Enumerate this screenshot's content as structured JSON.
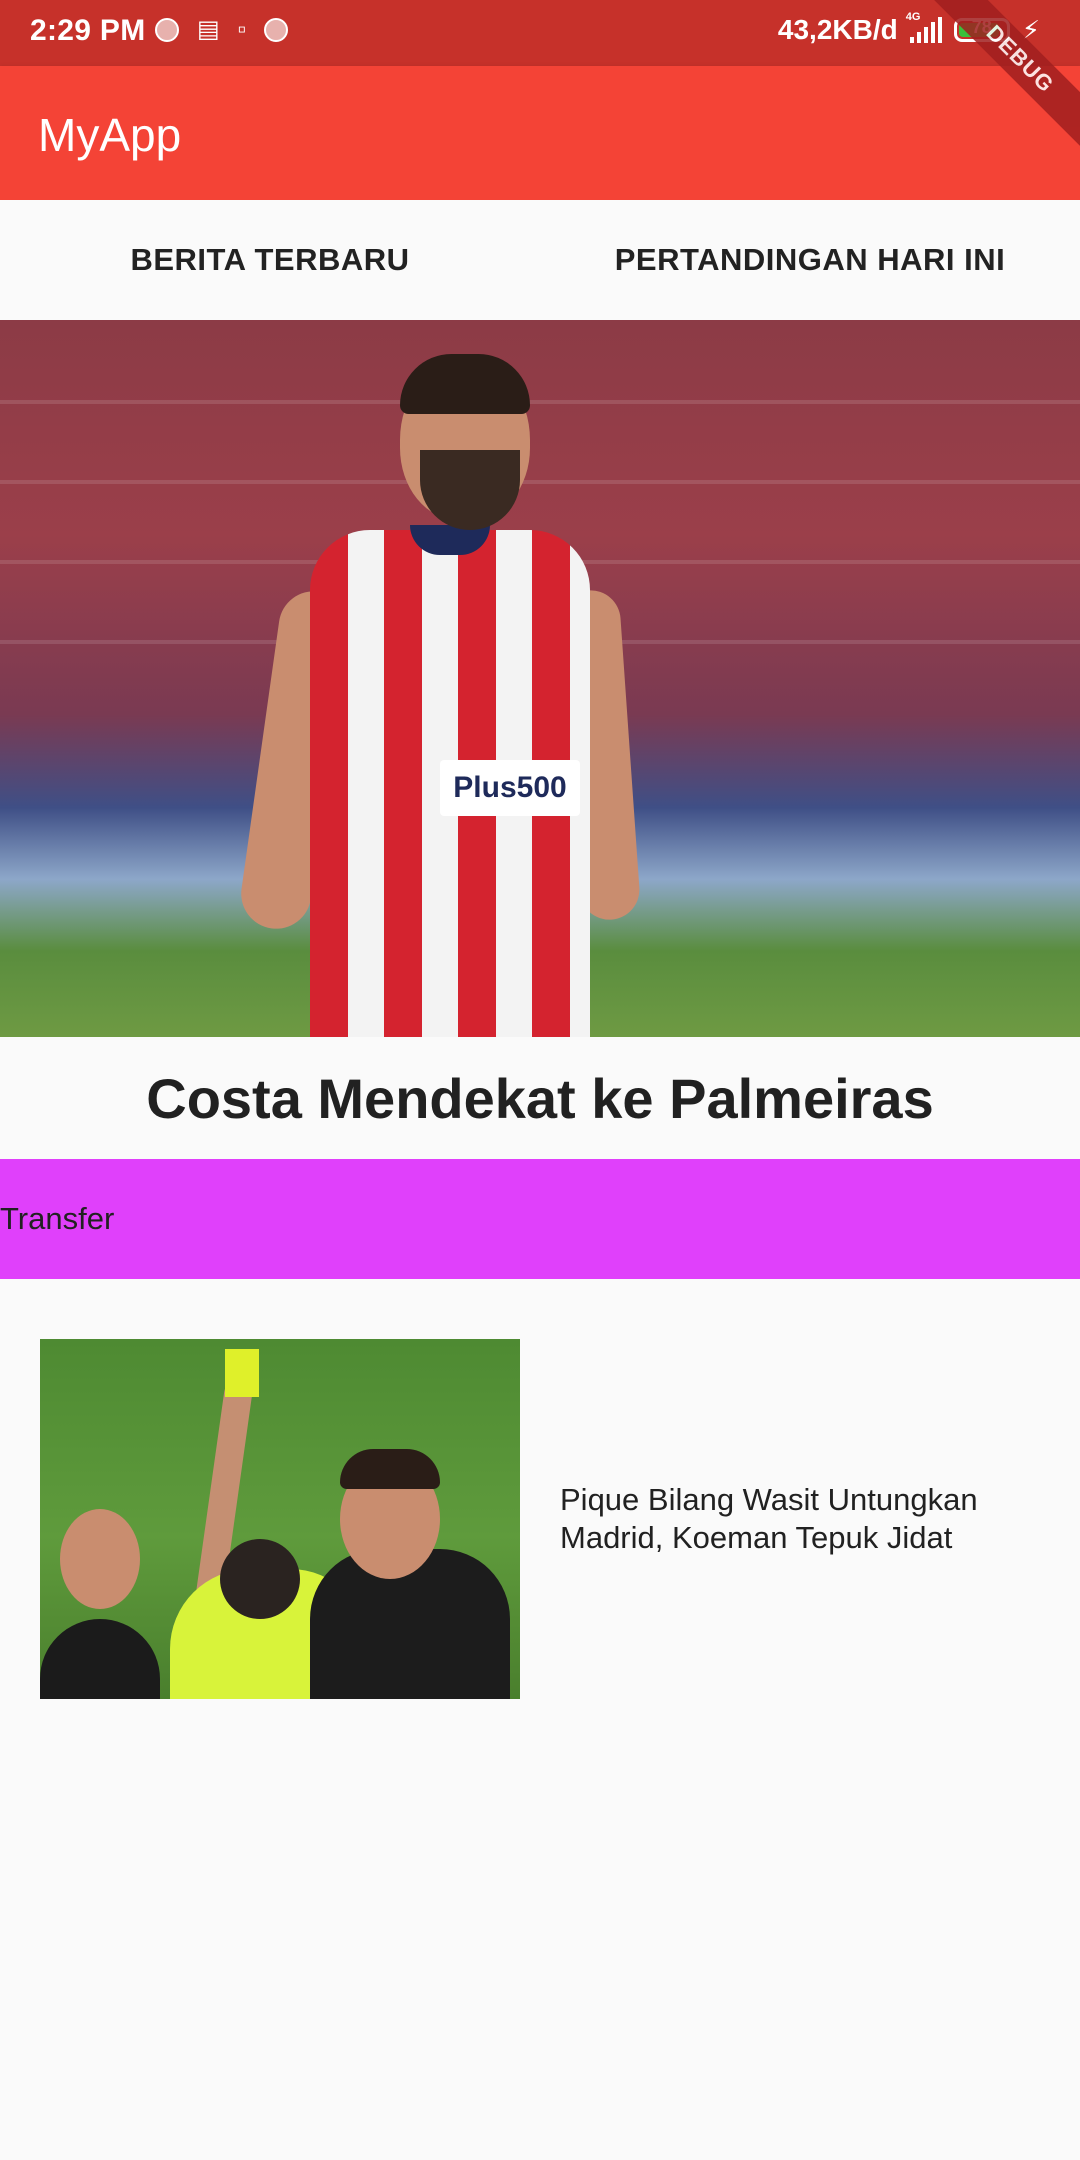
{
  "status_bar": {
    "time": "2:29 PM",
    "net_speed": "43,2KB/d",
    "network_type": "4G",
    "battery_level": "78",
    "icons": [
      "notification-icon",
      "shopping-bag-icon",
      "trash-icon",
      "notification-icon",
      "signal-icon",
      "battery-icon",
      "charging-icon"
    ]
  },
  "app_bar": {
    "title": "MyApp",
    "debug_banner": "DEBUG",
    "color": "#f44336"
  },
  "tabs": [
    {
      "label": "BERITA TERBARU"
    },
    {
      "label": "PERTANDINGAN HARI INI"
    }
  ],
  "featured": {
    "headline": "Costa Mendekat ke Palmeiras",
    "sponsor_text": "Plus500",
    "category": "Transfer",
    "category_color": "#e040fb"
  },
  "news_list": [
    {
      "title": "Pique Bilang Wasit Untungkan Madrid, Koeman Tepuk Jidat"
    }
  ]
}
